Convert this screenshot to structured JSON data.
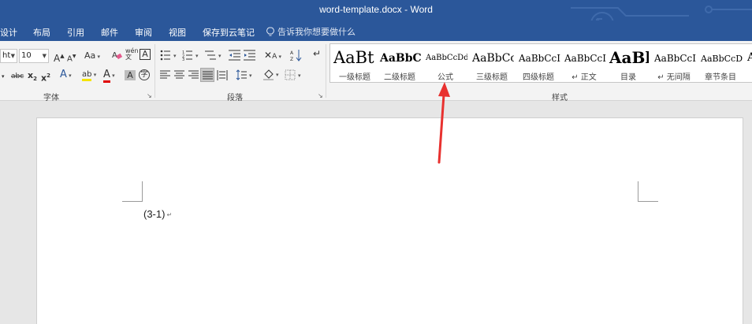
{
  "window": {
    "title": "word-template.docx  -  Word"
  },
  "tabs": [
    "设计",
    "布局",
    "引用",
    "邮件",
    "审阅",
    "视图",
    "保存到云笔记"
  ],
  "tell_me": {
    "placeholder": "告诉我你想要做什么"
  },
  "font_group": {
    "font_name": "ht",
    "font_size": "10",
    "label": "字体"
  },
  "paragraph_group": {
    "label": "段落"
  },
  "styles_group": {
    "label": "样式",
    "items": [
      {
        "preview": "AaBt",
        "name": "一级标题"
      },
      {
        "preview": "AaBbC",
        "name": "二级标题"
      },
      {
        "preview": "AaBbCcDdI",
        "name": "公式"
      },
      {
        "preview": "AaBbCc",
        "name": "三级标题"
      },
      {
        "preview": "AaBbCcI",
        "name": "四级标题"
      },
      {
        "preview": "AaBbCcI",
        "name": "↵ 正文"
      },
      {
        "preview": "AaBl",
        "name": "目录"
      },
      {
        "preview": "AaBbCcI",
        "name": "↵ 无间隔"
      },
      {
        "preview": "AaBbCcDc",
        "name": "章节条目"
      },
      {
        "preview": "A",
        "name": ""
      }
    ]
  },
  "document": {
    "text": "(3-1)",
    "paragraph_mark": "↵"
  },
  "colors": {
    "title_bar": "#2b579a",
    "annotation_arrow": "#e8312f"
  }
}
